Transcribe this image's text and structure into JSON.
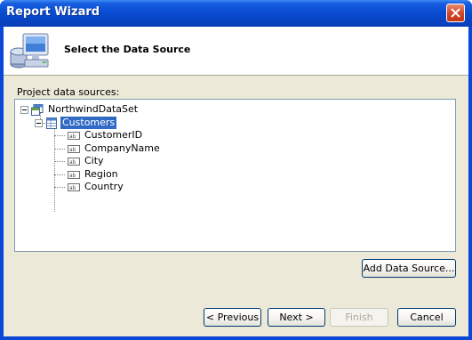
{
  "window": {
    "title": "Report Wizard"
  },
  "header": {
    "title": "Select the Data Source"
  },
  "data_sources": {
    "label": "Project data sources:",
    "root": "NorthwindDataSet",
    "table": "Customers",
    "fields": [
      "CustomerID",
      "CompanyName",
      "City",
      "Region",
      "Country"
    ]
  },
  "buttons": {
    "add_data_source": "Add Data Source...",
    "previous": "< Previous",
    "next": "Next >",
    "finish": "Finish",
    "cancel": "Cancel"
  },
  "colors": {
    "titlebar": "#0a4fd4",
    "selection": "#316ac5",
    "dialog": "#ece9d8"
  }
}
